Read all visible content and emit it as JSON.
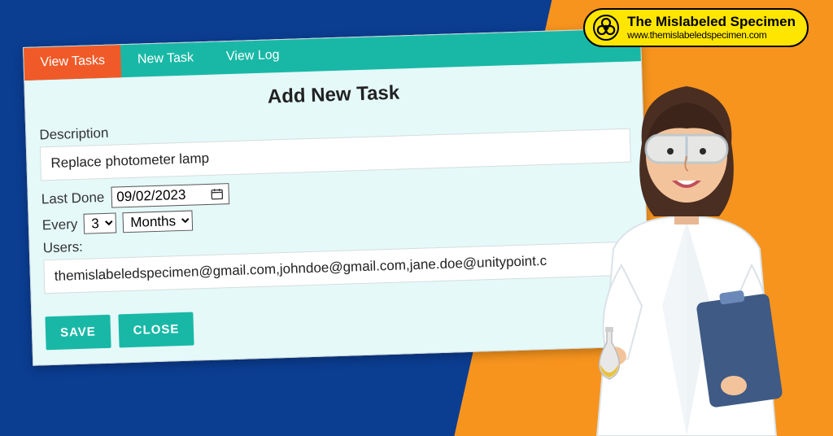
{
  "brand": {
    "title": "The Mislabeled Specimen",
    "url": "www.themislabeledspecimen.com"
  },
  "tabs": {
    "view_tasks": "View Tasks",
    "new_task": "New Task",
    "view_log": "View Log"
  },
  "form": {
    "title": "Add New Task",
    "description_label": "Description",
    "description_value": "Replace photometer lamp",
    "last_done_label": "Last Done",
    "last_done_value": "09/02/2023",
    "every_label": "Every",
    "every_number": "3",
    "every_unit": "Months",
    "users_label": "Users:",
    "users_value": "themislabeledspecimen@gmail.com,johndoe@gmail.com,jane.doe@unitypoint.c",
    "save": "SAVE",
    "close": "CLOSE"
  },
  "colors": {
    "bg_blue": "#0b3d91",
    "orange": "#f7941e",
    "teal": "#19b8a6",
    "tab_active": "#f05a28",
    "panel": "#e5f9f9",
    "brand_yellow": "#ffe600"
  }
}
